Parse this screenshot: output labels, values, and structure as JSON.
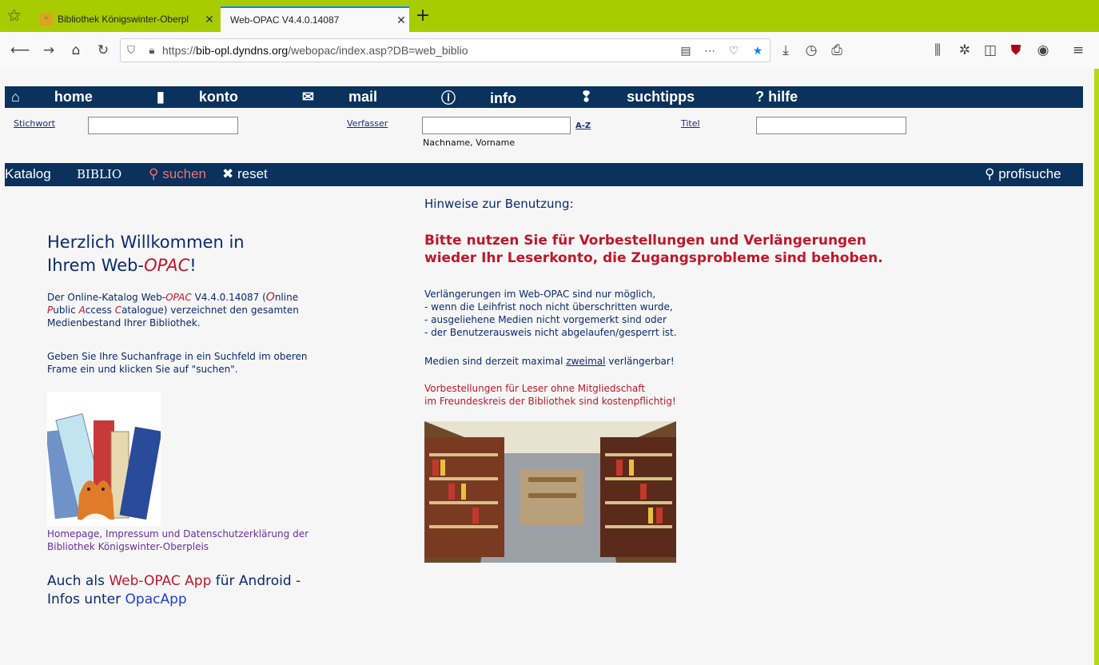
{
  "browser": {
    "tabs": [
      {
        "label": "Bibliothek Königswinter-Oberpl",
        "active": false
      },
      {
        "label": "Web-OPAC V4.4.0.14087",
        "active": true
      }
    ],
    "url_prefix": "https://",
    "url_host": "bib-opl.dyndns.org",
    "url_path": "/webopac/index.asp?DB=web_biblio",
    "accent_color": "#a8cc00"
  },
  "topnav": {
    "items": [
      {
        "label": "home",
        "icon": "house-icon"
      },
      {
        "label": "konto",
        "icon": "account-icon"
      },
      {
        "label": "mail",
        "icon": "mail-icon"
      },
      {
        "label": "info",
        "icon": "info-icon"
      },
      {
        "label": "suchtipps",
        "icon": "tip-icon"
      },
      {
        "label": "? hilfe",
        "icon": ""
      }
    ],
    "bg_color": "#0a325c"
  },
  "search": {
    "stichwort_label": "Stichwort",
    "stichwort_value": "",
    "verfasser_label": "Verfasser",
    "verfasser_value": "",
    "verfasser_hint": "Nachname, Vorname",
    "az_label": "A-Z",
    "titel_label": "Titel",
    "titel_value": ""
  },
  "catbar": {
    "katalog": "Katalog",
    "db": "BIBLIO",
    "suchen": "suchen",
    "reset": "reset",
    "profisuche": "profisuche"
  },
  "left": {
    "welcome_1": "Herzlich Willkommen in",
    "welcome_2a": "Ihrem Web-",
    "welcome_2b": "OPAC",
    "welcome_2c": "!",
    "intro_a": "Der Online-Katalog Web-",
    "intro_opac": "OPAC",
    "intro_b": " V4.4.0.14087 (",
    "intro_O": "O",
    "intro_c": "nline",
    "intro_P": "P",
    "intro_d": "ublic ",
    "intro_A": "A",
    "intro_e": "ccess ",
    "intro_C": "C",
    "intro_f": "atalogue) verzeichnet den gesamten",
    "intro_g": "Medienbestand Ihrer Bibliothek.",
    "instr_1": "Geben Sie Ihre Suchanfrage in ein Suchfeld im oberen",
    "instr_2": "Frame ein und klicken Sie auf \"suchen\".",
    "homepage_1": "Homepage, Impressum und Datenschutzerklärung der",
    "homepage_2": "Bibliothek Königswinter-Oberpleis",
    "app_a": "Auch als ",
    "app_red": "Web-OPAC App",
    "app_b": " für Android -",
    "app_c": "Infos unter ",
    "app_link": "OpacApp"
  },
  "right": {
    "hinweise": "Hinweise zur Benutzung:",
    "notice_1": "Bitte nutzen Sie für Vorbestellungen und Verlängerungen",
    "notice_2": "wieder Ihr Leserkonto, die Zugangsprobleme sind behoben.",
    "rules": [
      "Verlängerungen im Web-OPAC sind nur möglich,",
      "- wenn die Leihfrist noch nicht überschritten wurde,",
      "- ausgeliehene Medien nicht vorgemerkt sind oder",
      "- der Benutzerausweis nicht abgelaufen/gesperrt ist."
    ],
    "max_a": "Medien sind derzeit maximal ",
    "max_link": "zweimal",
    "max_b": " verlängerbar!",
    "fee_1": "Vorbestellungen für Leser ohne Mitgliedschaft",
    "fee_2": "im Freundeskreis der Bibliothek sind kostenpflichtig!"
  }
}
